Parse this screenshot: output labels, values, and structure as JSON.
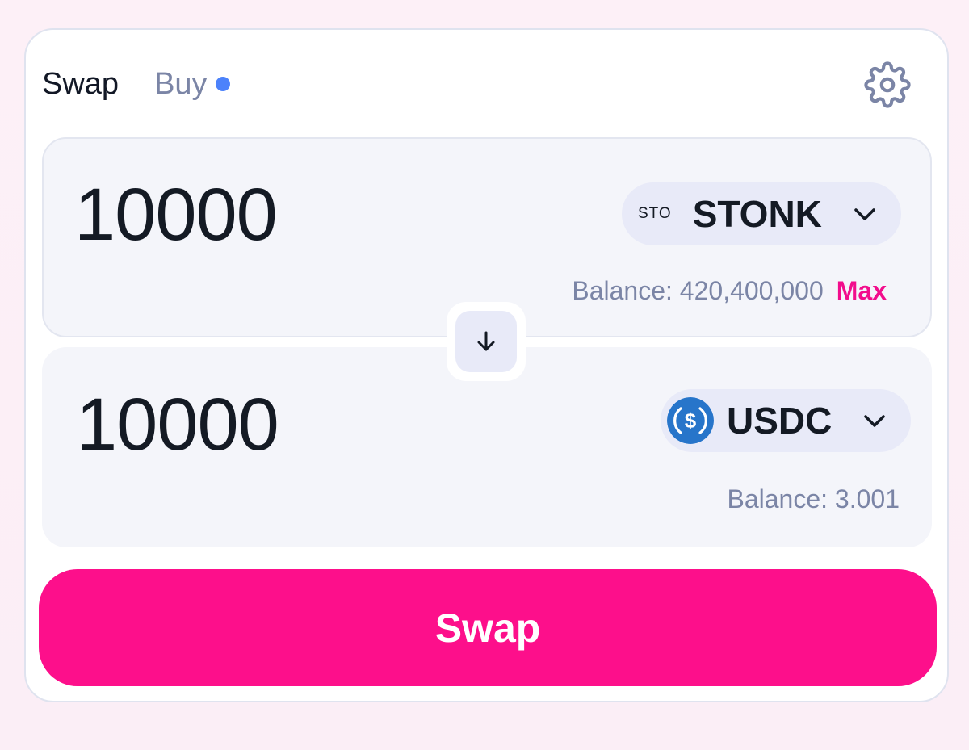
{
  "tabs": {
    "swap_label": "Swap",
    "buy_label": "Buy"
  },
  "settings": {
    "icon": "gear-icon"
  },
  "input_panel": {
    "amount": "10000",
    "token_prefix": "STO",
    "token_symbol": "STONK",
    "balance_text": "Balance: 420,400,000",
    "max_label": "Max"
  },
  "output_panel": {
    "amount": "10000",
    "token_icon": "usdc-logo-icon",
    "token_symbol": "USDC",
    "balance_text": "Balance: 3.001"
  },
  "switch_button": {
    "icon": "arrow-down-icon"
  },
  "swap_button": {
    "label": "Swap"
  },
  "colors": {
    "accent_pink": "#fd0f8b",
    "notify_dot": "#4c82fb",
    "usdc_blue": "#2775ca",
    "muted_text": "#7b85a6"
  }
}
